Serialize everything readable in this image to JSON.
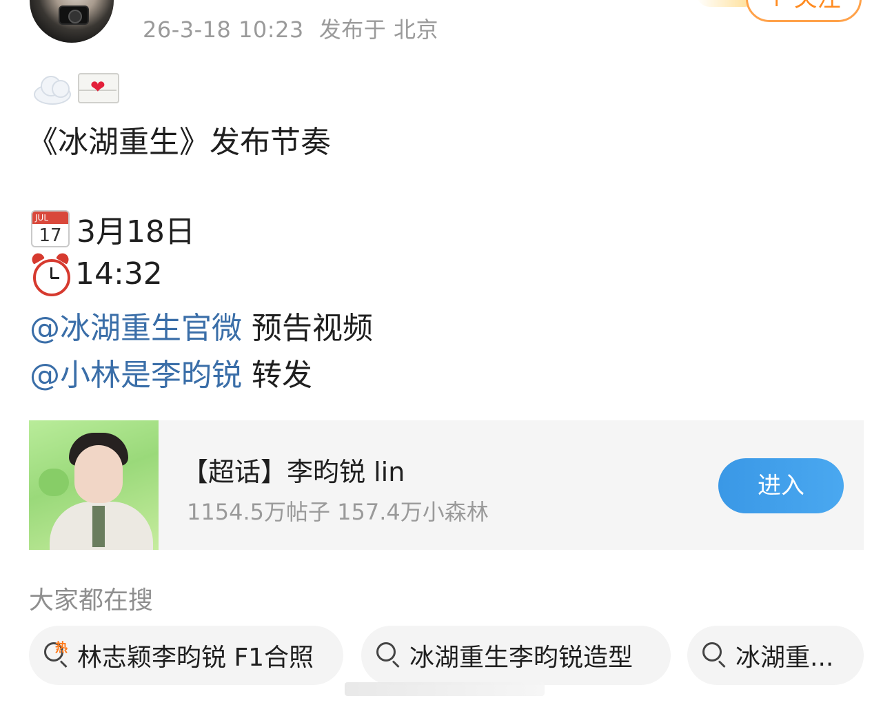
{
  "header": {
    "timestamp": "26-3-18 10:23",
    "location": "发布于 北京",
    "follow_label": "+ 关注"
  },
  "post": {
    "emojis": [
      "cloud-emoji",
      "love-letter-emoji"
    ],
    "title": "《冰湖重生》发布节奏",
    "date": "3月18日",
    "time": "14:32",
    "mentions": [
      {
        "handle": "@冰湖重生官微",
        "text": " 预告视频"
      },
      {
        "handle": "@小林是李昀锐",
        "text": " 转发"
      }
    ]
  },
  "super_topic": {
    "title": "【超话】李昀锐 lin",
    "stats": "1154.5万帖子 157.4万小森林",
    "enter_label": "进入"
  },
  "search": {
    "heading": "大家都在搜",
    "chips": [
      {
        "label": "林志颖李昀锐 F1合照",
        "icon": "hot-search-icon",
        "hot_badge": "热"
      },
      {
        "label": "冰湖重生李昀锐造型",
        "icon": "search-icon"
      },
      {
        "label": "冰湖重...",
        "icon": "search-icon"
      }
    ]
  },
  "colors": {
    "mention": "#3a6ea8",
    "follow": "#ff8a1f",
    "enter_button": "#3a98e6",
    "meta_text": "#9a9a9a"
  }
}
